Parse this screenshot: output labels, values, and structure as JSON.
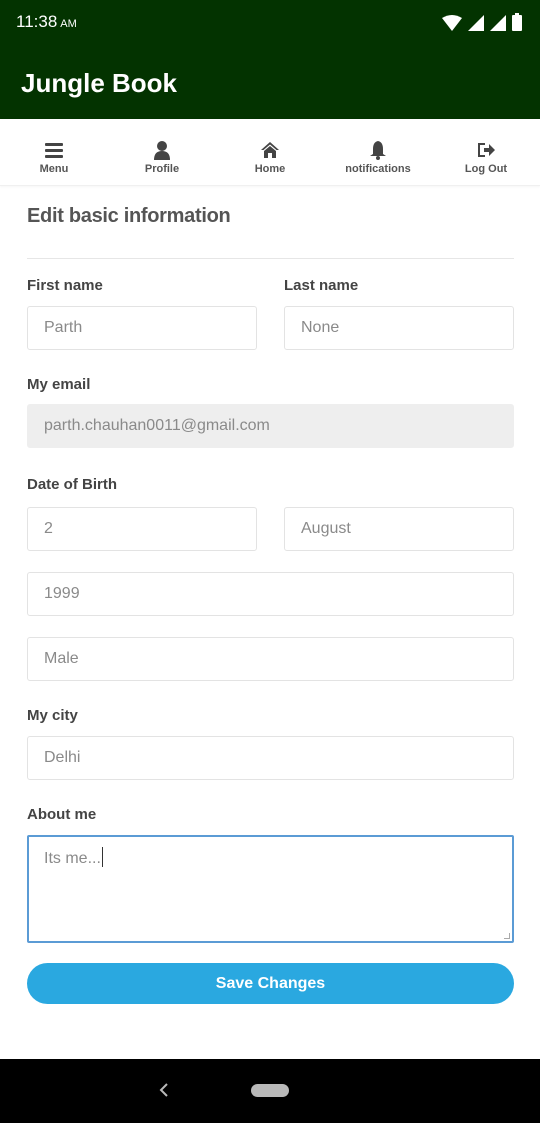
{
  "status_bar": {
    "time": "11:38",
    "ampm": "AM"
  },
  "app": {
    "title": "Jungle Book",
    "brand_color": "#033300"
  },
  "nav": [
    {
      "label": "Menu",
      "icon": "menu-icon"
    },
    {
      "label": "Profile",
      "icon": "user-icon"
    },
    {
      "label": "Home",
      "icon": "home-icon"
    },
    {
      "label": "notifications",
      "icon": "bell-icon"
    },
    {
      "label": "Log Out",
      "icon": "logout-icon"
    }
  ],
  "form": {
    "title": "Edit basic information",
    "first_name_label": "First name",
    "first_name": "Parth",
    "last_name_label": "Last name",
    "last_name": "None",
    "email_label": "My email",
    "email": "parth.chauhan0011@gmail.com",
    "dob_label": "Date of Birth",
    "dob_day": "2",
    "dob_month": "August",
    "dob_year": "1999",
    "gender": "Male",
    "city_label": "My city",
    "city": "Delhi",
    "about_label": "About me",
    "about": "Its me...",
    "save_label": "Save Changes",
    "save_color": "#2aa8e0"
  }
}
